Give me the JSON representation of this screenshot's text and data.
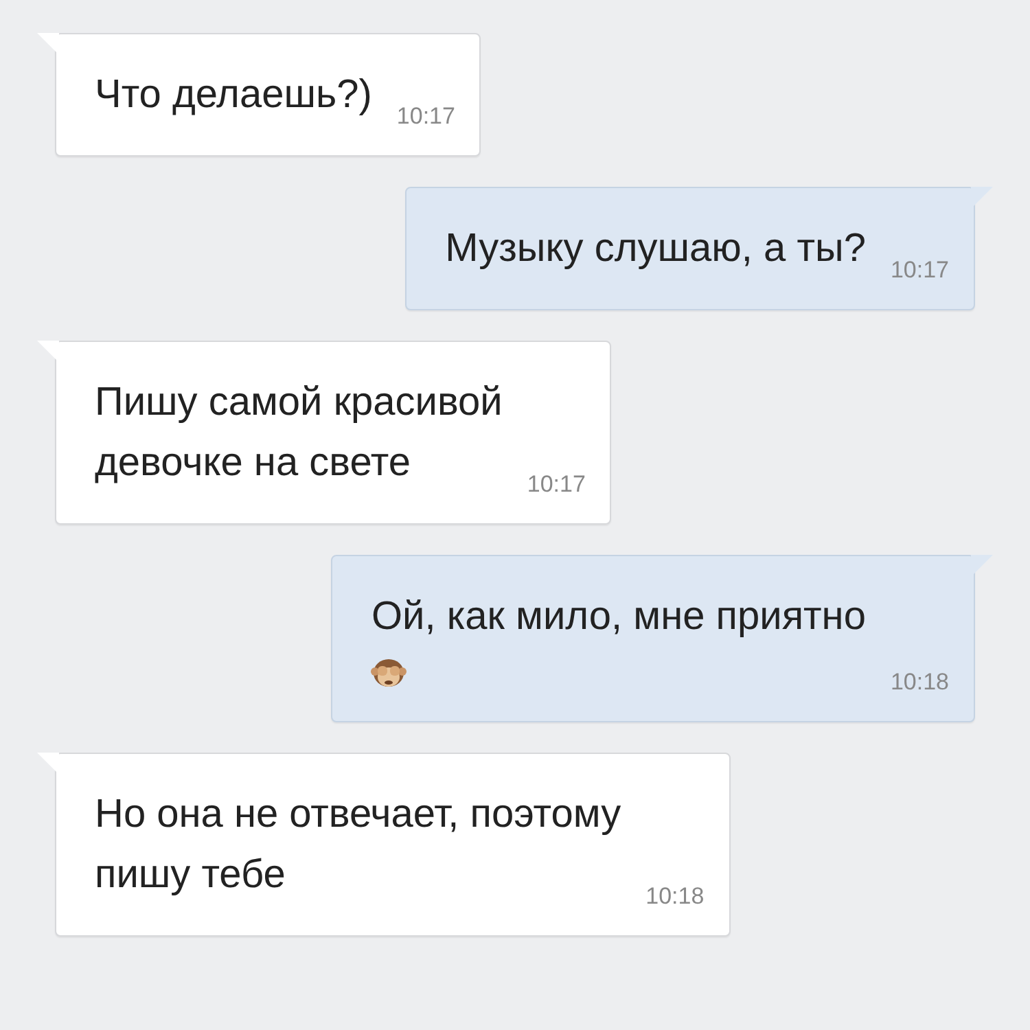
{
  "messages": [
    {
      "kind": "incoming",
      "text": "Что делаешь?)",
      "emoji": false,
      "time": "10:17"
    },
    {
      "kind": "outgoing",
      "text": "Музыку слушаю, а ты?",
      "emoji": false,
      "time": "10:17"
    },
    {
      "kind": "incoming",
      "text": "Пишу самой красивой\nдевочке на свете",
      "emoji": false,
      "time": "10:17"
    },
    {
      "kind": "outgoing",
      "text": "Ой, как мило, мне приятно",
      "emoji": true,
      "time": "10:18"
    },
    {
      "kind": "incoming",
      "text": "Но она не отвечает, поэтому\nпишу тебе",
      "emoji": false,
      "time": "10:18"
    }
  ]
}
